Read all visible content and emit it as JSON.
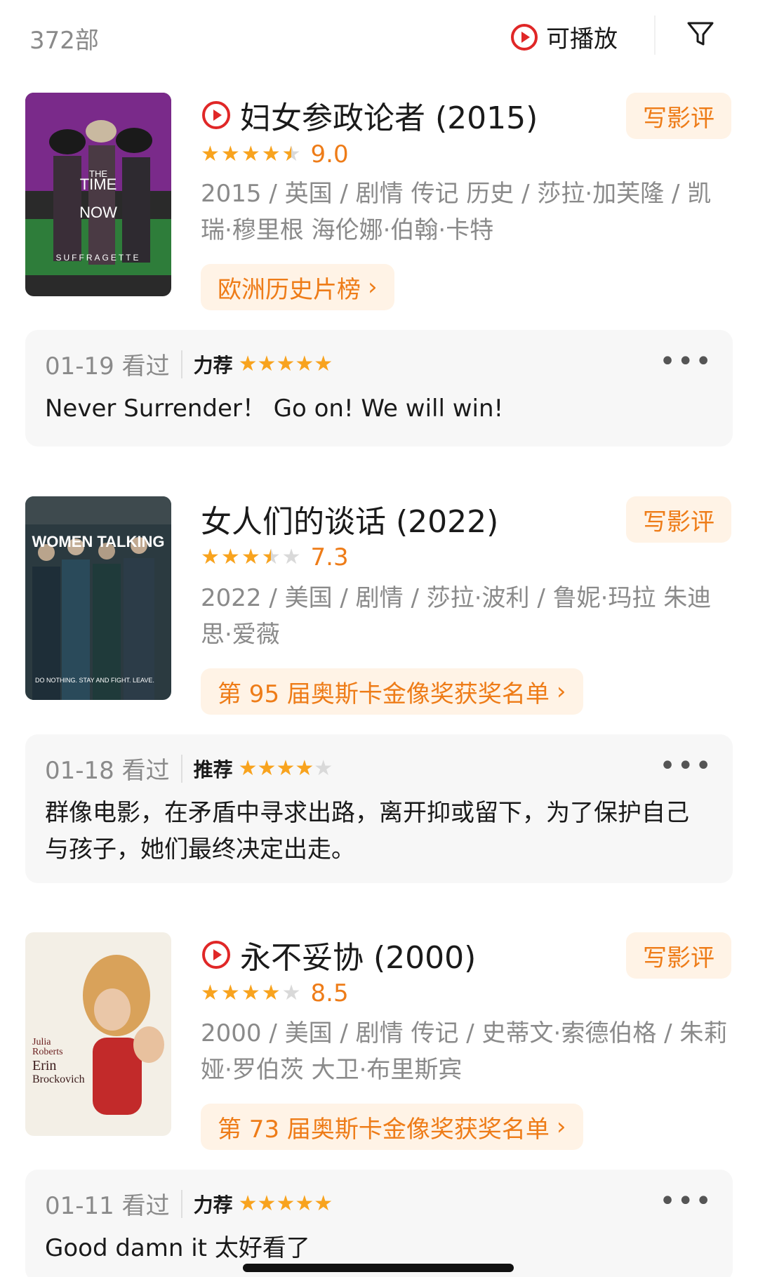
{
  "header": {
    "count": "372部",
    "playable_label": "可播放",
    "accent_color": "#ee7c18",
    "play_color": "#e02727"
  },
  "movies": [
    {
      "title": "妇女参政论者 (2015)",
      "playable": true,
      "rating": 9.0,
      "rating_text": "9.0",
      "stars": 4.5,
      "meta": "2015 / 英国 / 剧情 传记 历史 / 莎拉·加芙隆 / 凯瑞·穆里根 海伦娜·伯翰·卡特",
      "write_review": "写影评",
      "list_chip": "欧洲历史片榜",
      "poster_alt": "SUFFRAGETTE poster",
      "review": {
        "date": "01-19 看过",
        "level": "力荐",
        "stars": 5,
        "text": "Never Surrender！ Go on! We will win!"
      }
    },
    {
      "title": "女人们的谈话 (2022)",
      "playable": false,
      "rating": 7.3,
      "rating_text": "7.3",
      "stars": 3.5,
      "meta": "2022 / 美国 / 剧情 / 莎拉·波利 / 鲁妮·玛拉 朱迪思·爱薇",
      "write_review": "写影评",
      "list_chip": "第 95 届奥斯卡金像奖获奖名单",
      "poster_alt": "WOMEN TALKING poster",
      "review": {
        "date": "01-18 看过",
        "level": "推荐",
        "stars": 4,
        "text": "群像电影，在矛盾中寻求出路，离开抑或留下，为了保护自己与孩子，她们最终决定出走。"
      }
    },
    {
      "title": "永不妥协 (2000)",
      "playable": true,
      "rating": 8.5,
      "rating_text": "8.5",
      "stars": 4,
      "meta": "2000 / 美国 / 剧情 传记 / 史蒂文·索德伯格 / 朱莉娅·罗伯茨 大卫·布里斯宾",
      "write_review": "写影评",
      "list_chip": "第 73 届奥斯卡金像奖获奖名单",
      "poster_alt": "Erin Brockovich poster",
      "review": {
        "date": "01-11 看过",
        "level": "力荐",
        "stars": 5,
        "text": "Good damn it 太好看了"
      }
    }
  ]
}
